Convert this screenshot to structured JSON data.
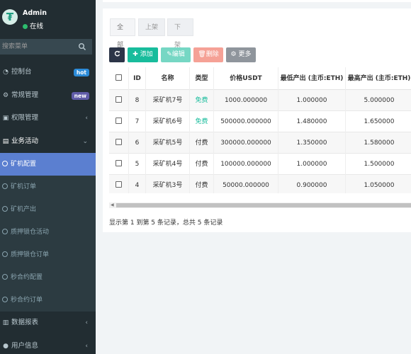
{
  "user": {
    "name": "Admin",
    "status": "在线"
  },
  "search": {
    "placeholder": "搜索菜单"
  },
  "menu": [
    {
      "label": "控制台",
      "icon": "dashboard-icon",
      "badge": "hot"
    },
    {
      "label": "常规管理",
      "icon": "cogs-icon",
      "badge": "new"
    },
    {
      "label": "权限管理",
      "icon": "group-icon"
    },
    {
      "label": "业务活动",
      "icon": "list-icon"
    }
  ],
  "submenu": [
    {
      "label": "矿机配置",
      "active": true
    },
    {
      "label": "矿机订单"
    },
    {
      "label": "矿机产出"
    },
    {
      "label": "质押锁仓活动"
    },
    {
      "label": "质押锁仓订单"
    },
    {
      "label": "秒合约配置"
    },
    {
      "label": "秒合约订单"
    }
  ],
  "menu_bottom": [
    {
      "label": "数据报表",
      "icon": "report-icon"
    },
    {
      "label": "用户信息",
      "icon": "user-icon"
    }
  ],
  "tabs": [
    "全部",
    "上架",
    "下架"
  ],
  "toolbar": {
    "add": "添加",
    "edit": "编辑",
    "delete": "删除",
    "more": "更多"
  },
  "table": {
    "columns": [
      "ID",
      "名称",
      "类型",
      "价格USDT",
      "最低产出 (主币:ETH)",
      "最高产出 (主币:ETH)"
    ],
    "rows": [
      {
        "id": "8",
        "name": "采矿机7号",
        "type": "免费",
        "price": "1000.000000",
        "min": "1.000000",
        "max": "5.000000"
      },
      {
        "id": "7",
        "name": "采矿机6号",
        "type": "免费",
        "price": "500000.000000",
        "min": "1.480000",
        "max": "1.650000"
      },
      {
        "id": "6",
        "name": "采矿机5号",
        "type": "付费",
        "price": "300000.000000",
        "min": "1.350000",
        "max": "1.580000"
      },
      {
        "id": "5",
        "name": "采矿机4号",
        "type": "付费",
        "price": "100000.000000",
        "min": "1.000000",
        "max": "1.500000"
      },
      {
        "id": "4",
        "name": "采矿机3号",
        "type": "付费",
        "price": "50000.000000",
        "min": "0.900000",
        "max": "1.050000"
      }
    ]
  },
  "pagination": {
    "info": "显示第 1 到第 5 条记录，总共 5 条记录"
  },
  "colors": {
    "sidebar": "#222d32",
    "active": "#5b7fd0",
    "success": "#18bc9c"
  }
}
